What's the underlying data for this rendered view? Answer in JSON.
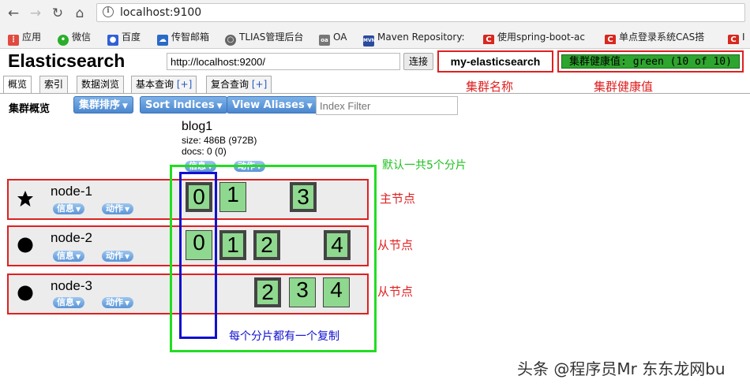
{
  "browser": {
    "url": "localhost:9100",
    "bookmarks": [
      {
        "label": "应用",
        "icon": "apps-grid-icon",
        "color": "#e04a3f"
      },
      {
        "label": "微信",
        "icon": "wechat-icon",
        "color": "#2aae2a"
      },
      {
        "label": "百度",
        "icon": "baidu-paw-icon",
        "color": "#3060d8"
      },
      {
        "label": "传智邮箱",
        "icon": "mail-cloud-icon",
        "color": "#2a6ac8"
      },
      {
        "label": "TLIAS管理后台",
        "icon": "globe-icon",
        "color": "#666666"
      },
      {
        "label": "OA",
        "icon": "oa-icon",
        "color": "#777777"
      },
      {
        "label": "Maven Repository:",
        "icon": "mvn-icon",
        "color": "#2a4aa0"
      },
      {
        "label": "使用spring-boot-ac",
        "icon": "csdn-c-icon",
        "color": "#d8281e"
      },
      {
        "label": "单点登录系统CAS搭",
        "icon": "csdn-c-icon",
        "color": "#d8281e"
      },
      {
        "label": "I",
        "icon": "csdn-c-icon",
        "color": "#d8281e"
      }
    ]
  },
  "header": {
    "title": "Elasticsearch",
    "connect_url": "http://localhost:9200/",
    "connect_label": "连接",
    "cluster_name": "my-elasticsearch",
    "health": "集群健康值: green (10 of 10)",
    "health_color": "#2ea52e"
  },
  "tabs": [
    {
      "label": "概览",
      "plus": ""
    },
    {
      "label": "索引",
      "plus": ""
    },
    {
      "label": "数据浏览",
      "plus": ""
    },
    {
      "label": "基本查询",
      "plus": "[+]"
    },
    {
      "label": "复合查询",
      "plus": "[+]"
    }
  ],
  "toolbar": {
    "label": "集群概览",
    "sort_cluster": "集群排序",
    "sort_indices": "Sort Indices",
    "view_aliases": "View Aliases",
    "index_filter_placeholder": "Index Filter"
  },
  "index": {
    "name": "blog1",
    "size": "size: 486B (972B)",
    "docs": "docs: 0 (0)",
    "info_label": "信息",
    "action_label": "动作"
  },
  "nodes": [
    {
      "name": "node-1",
      "symbol": "star",
      "info_label": "信息",
      "action_label": "动作",
      "shards": [
        "0",
        "1",
        "3"
      ]
    },
    {
      "name": "node-2",
      "symbol": "circle",
      "info_label": "信息",
      "action_label": "动作",
      "shards": [
        "0",
        "1",
        "2",
        "4"
      ]
    },
    {
      "name": "node-3",
      "symbol": "circle",
      "info_label": "信息",
      "action_label": "动作",
      "shards": [
        "2",
        "3",
        "4"
      ]
    }
  ],
  "annotations": {
    "cluster_name": "集群名称",
    "cluster_health": "集群健康值",
    "default_shards": "默认一共5个分片",
    "master_node": "主节点",
    "slave_node_1": "从节点",
    "slave_node_2": "从节点",
    "replica_note": "每个分片都有一个复制"
  },
  "watermark": "头条 @程序员Mr 东东龙网bu"
}
